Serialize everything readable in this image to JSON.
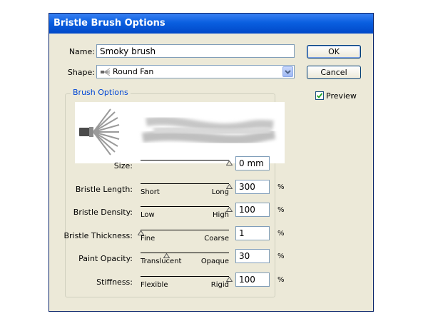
{
  "window": {
    "title": "Bristle Brush Options"
  },
  "name": {
    "label": "Name:",
    "value": "Smoky brush"
  },
  "shape": {
    "label": "Shape:",
    "value": "Round Fan",
    "icon": "round-fan-brush-icon"
  },
  "buttons": {
    "ok": "OK",
    "cancel": "Cancel"
  },
  "preview": {
    "label": "Preview",
    "checked": true
  },
  "group": {
    "title": "Brush Options"
  },
  "sliders": [
    {
      "label": "Size:",
      "value": "0 mm",
      "min_label": "",
      "max_label": "",
      "unit": "",
      "position": 1.0
    },
    {
      "label": "Bristle Length:",
      "value": "300",
      "min_label": "Short",
      "max_label": "Long",
      "unit": "%",
      "position": 1.0
    },
    {
      "label": "Bristle Density:",
      "value": "100",
      "min_label": "Low",
      "max_label": "High",
      "unit": "%",
      "position": 1.0
    },
    {
      "label": "Bristle Thickness:",
      "value": "1",
      "min_label": "Fine",
      "max_label": "Coarse",
      "unit": "%",
      "position": 0.0
    },
    {
      "label": "Paint Opacity:",
      "value": "30",
      "min_label": "Translucent",
      "max_label": "Opaque",
      "unit": "%",
      "position": 0.29
    },
    {
      "label": "Stiffness:",
      "value": "100",
      "min_label": "Flexible",
      "max_label": "Rigid",
      "unit": "%",
      "position": 1.0
    }
  ],
  "colors": {
    "title_bar": "#0a5fe0",
    "group_title": "#0046d5",
    "dialog_bg": "#ece9d8"
  }
}
